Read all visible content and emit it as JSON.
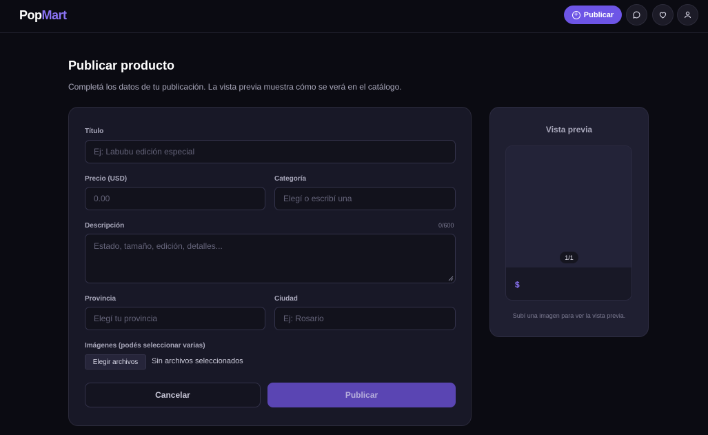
{
  "header": {
    "logo_part1": "Pop",
    "logo_part2": "Mart",
    "publish_label": "Publicar",
    "icons": [
      "chat-icon",
      "heart-icon",
      "user-icon"
    ]
  },
  "page": {
    "title": "Publicar producto",
    "subtitle": "Completá los datos de tu publicación. La vista previa muestra cómo se verá en el catálogo."
  },
  "form": {
    "title_label": "Título",
    "title_placeholder": "Ej: Labubu edición especial",
    "price_label": "Precio (USD)",
    "price_placeholder": "0.00",
    "category_label": "Categoría",
    "category_placeholder": "Elegí o escribí una",
    "description_label": "Descripción",
    "description_counter": "0/600",
    "description_placeholder": "Estado, tamaño, edición, detalles...",
    "province_label": "Provincia",
    "province_placeholder": "Elegí tu provincia",
    "city_label": "Ciudad",
    "city_placeholder": "Ej: Rosario",
    "images_label": "Imágenes (podés seleccionar varias)",
    "file_button": "Elegir archivos",
    "file_status": "Sin archivos seleccionados",
    "cancel_label": "Cancelar",
    "submit_label": "Publicar"
  },
  "preview": {
    "title": "Vista previa",
    "pager": "1/1",
    "price": "$",
    "hint": "Subí una imagen para ver la vista previa."
  },
  "colors": {
    "background": "#0b0b12",
    "card": "#181827",
    "accent": "#6d55e6",
    "accent_text": "#8b74f5"
  }
}
